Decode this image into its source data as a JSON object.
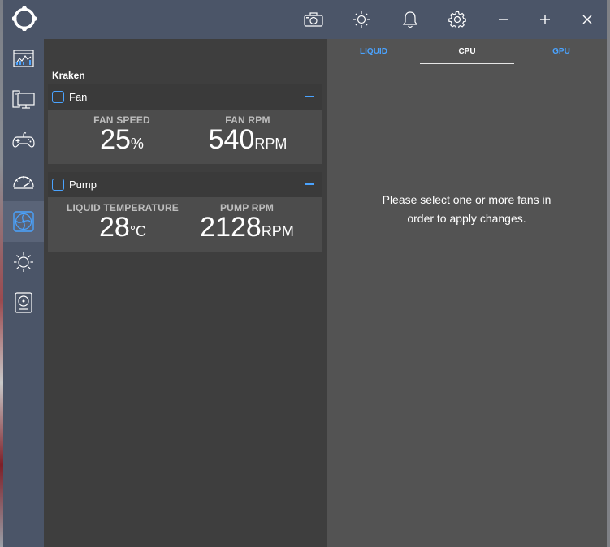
{
  "titlebar": {
    "icons": [
      "camera-icon",
      "brightness-icon",
      "bell-icon",
      "gear-icon"
    ],
    "window_controls": [
      "minimize-icon",
      "maximize-icon",
      "close-icon"
    ]
  },
  "sidebar": {
    "items": [
      {
        "icon": "dashboard-icon",
        "active": false
      },
      {
        "icon": "pc-monitor-icon",
        "active": false
      },
      {
        "icon": "gamepad-icon",
        "active": false
      },
      {
        "icon": "speedometer-icon",
        "active": false
      },
      {
        "icon": "fan-icon",
        "active": true
      },
      {
        "icon": "sun-icon",
        "active": false
      },
      {
        "icon": "drive-icon",
        "active": false
      }
    ]
  },
  "device": {
    "title": "Kraken"
  },
  "fan_card": {
    "name": "Fan",
    "speed_label": "FAN SPEED",
    "speed_value": "25",
    "speed_unit": "%",
    "rpm_label": "FAN RPM",
    "rpm_value": "540",
    "rpm_unit": "RPM"
  },
  "pump_card": {
    "name": "Pump",
    "temp_label": "LIQUID TEMPERATURE",
    "temp_value": "28",
    "temp_unit": "°C",
    "rpm_label": "PUMP RPM",
    "rpm_value": "2128",
    "rpm_unit": "RPM"
  },
  "tabs": {
    "liquid": "LIQUID",
    "cpu": "CPU",
    "gpu": "GPU",
    "selected": "CPU"
  },
  "message": {
    "line1": "Please select one or more fans in",
    "line2": "order to apply changes."
  },
  "colors": {
    "accent": "#4aa3ff",
    "titlebar": "#4b5568",
    "panel": "#3e3e3e",
    "right_panel": "#535353"
  }
}
